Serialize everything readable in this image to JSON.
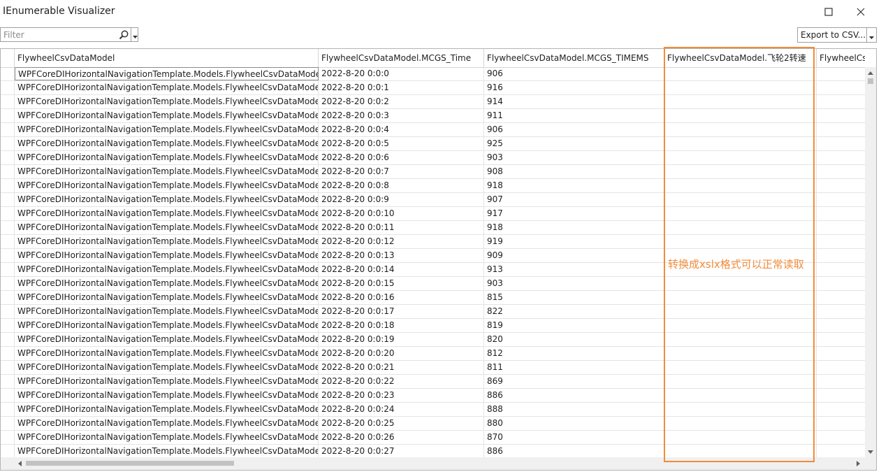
{
  "window": {
    "title": "IEnumerable Visualizer",
    "minimize_icon": "minimize-icon",
    "maximize_icon": "maximize-icon",
    "close_icon": "close-icon"
  },
  "toolbar": {
    "filter_placeholder": "Filter",
    "filter_value": "",
    "search_icon": "search-icon",
    "dropdown_icon": "chevron-down-icon",
    "export_label": "Export to CSV..."
  },
  "grid": {
    "columns": [
      "FlywheelCsvDataModel",
      "FlywheelCsvDataModel.MCGS_Time",
      "FlywheelCsvDataModel.MCGS_TIMEMS",
      "FlywheelCsvDataModel.飞轮2转速",
      "FlywheelCsv"
    ],
    "rows": [
      [
        "WPFCoreDIHorizontalNavigationTemplate.Models.FlywheelCsvDataModel",
        "2022-8-20 0:0:0",
        "906",
        "",
        ""
      ],
      [
        "WPFCoreDIHorizontalNavigationTemplate.Models.FlywheelCsvDataModel",
        "2022-8-20 0:0:1",
        "916",
        "",
        ""
      ],
      [
        "WPFCoreDIHorizontalNavigationTemplate.Models.FlywheelCsvDataModel",
        "2022-8-20 0:0:2",
        "914",
        "",
        ""
      ],
      [
        "WPFCoreDIHorizontalNavigationTemplate.Models.FlywheelCsvDataModel",
        "2022-8-20 0:0:3",
        "911",
        "",
        ""
      ],
      [
        "WPFCoreDIHorizontalNavigationTemplate.Models.FlywheelCsvDataModel",
        "2022-8-20 0:0:4",
        "906",
        "",
        ""
      ],
      [
        "WPFCoreDIHorizontalNavigationTemplate.Models.FlywheelCsvDataModel",
        "2022-8-20 0:0:5",
        "925",
        "",
        ""
      ],
      [
        "WPFCoreDIHorizontalNavigationTemplate.Models.FlywheelCsvDataModel",
        "2022-8-20 0:0:6",
        "903",
        "",
        ""
      ],
      [
        "WPFCoreDIHorizontalNavigationTemplate.Models.FlywheelCsvDataModel",
        "2022-8-20 0:0:7",
        "908",
        "",
        ""
      ],
      [
        "WPFCoreDIHorizontalNavigationTemplate.Models.FlywheelCsvDataModel",
        "2022-8-20 0:0:8",
        "918",
        "",
        ""
      ],
      [
        "WPFCoreDIHorizontalNavigationTemplate.Models.FlywheelCsvDataModel",
        "2022-8-20 0:0:9",
        "907",
        "",
        ""
      ],
      [
        "WPFCoreDIHorizontalNavigationTemplate.Models.FlywheelCsvDataModel",
        "2022-8-20 0:0:10",
        "917",
        "",
        ""
      ],
      [
        "WPFCoreDIHorizontalNavigationTemplate.Models.FlywheelCsvDataModel",
        "2022-8-20 0:0:11",
        "918",
        "",
        ""
      ],
      [
        "WPFCoreDIHorizontalNavigationTemplate.Models.FlywheelCsvDataModel",
        "2022-8-20 0:0:12",
        "919",
        "",
        ""
      ],
      [
        "WPFCoreDIHorizontalNavigationTemplate.Models.FlywheelCsvDataModel",
        "2022-8-20 0:0:13",
        "909",
        "",
        ""
      ],
      [
        "WPFCoreDIHorizontalNavigationTemplate.Models.FlywheelCsvDataModel",
        "2022-8-20 0:0:14",
        "913",
        "",
        ""
      ],
      [
        "WPFCoreDIHorizontalNavigationTemplate.Models.FlywheelCsvDataModel",
        "2022-8-20 0:0:15",
        "903",
        "",
        ""
      ],
      [
        "WPFCoreDIHorizontalNavigationTemplate.Models.FlywheelCsvDataModel",
        "2022-8-20 0:0:16",
        "815",
        "",
        ""
      ],
      [
        "WPFCoreDIHorizontalNavigationTemplate.Models.FlywheelCsvDataModel",
        "2022-8-20 0:0:17",
        "822",
        "",
        ""
      ],
      [
        "WPFCoreDIHorizontalNavigationTemplate.Models.FlywheelCsvDataModel",
        "2022-8-20 0:0:18",
        "819",
        "",
        ""
      ],
      [
        "WPFCoreDIHorizontalNavigationTemplate.Models.FlywheelCsvDataModel",
        "2022-8-20 0:0:19",
        "820",
        "",
        ""
      ],
      [
        "WPFCoreDIHorizontalNavigationTemplate.Models.FlywheelCsvDataModel",
        "2022-8-20 0:0:20",
        "812",
        "",
        ""
      ],
      [
        "WPFCoreDIHorizontalNavigationTemplate.Models.FlywheelCsvDataModel",
        "2022-8-20 0:0:21",
        "811",
        "",
        ""
      ],
      [
        "WPFCoreDIHorizontalNavigationTemplate.Models.FlywheelCsvDataModel",
        "2022-8-20 0:0:22",
        "869",
        "",
        ""
      ],
      [
        "WPFCoreDIHorizontalNavigationTemplate.Models.FlywheelCsvDataModel",
        "2022-8-20 0:0:23",
        "886",
        "",
        ""
      ],
      [
        "WPFCoreDIHorizontalNavigationTemplate.Models.FlywheelCsvDataModel",
        "2022-8-20 0:0:24",
        "888",
        "",
        ""
      ],
      [
        "WPFCoreDIHorizontalNavigationTemplate.Models.FlywheelCsvDataModel",
        "2022-8-20 0:0:25",
        "880",
        "",
        ""
      ],
      [
        "WPFCoreDIHorizontalNavigationTemplate.Models.FlywheelCsvDataModel",
        "2022-8-20 0:0:26",
        "870",
        "",
        ""
      ],
      [
        "WPFCoreDIHorizontalNavigationTemplate.Models.FlywheelCsvDataModel",
        "2022-8-20 0:0:27",
        "886",
        "",
        ""
      ]
    ]
  },
  "annotation": {
    "text": "转换成xslx格式可以正常读取",
    "color": "#f28c3b"
  }
}
